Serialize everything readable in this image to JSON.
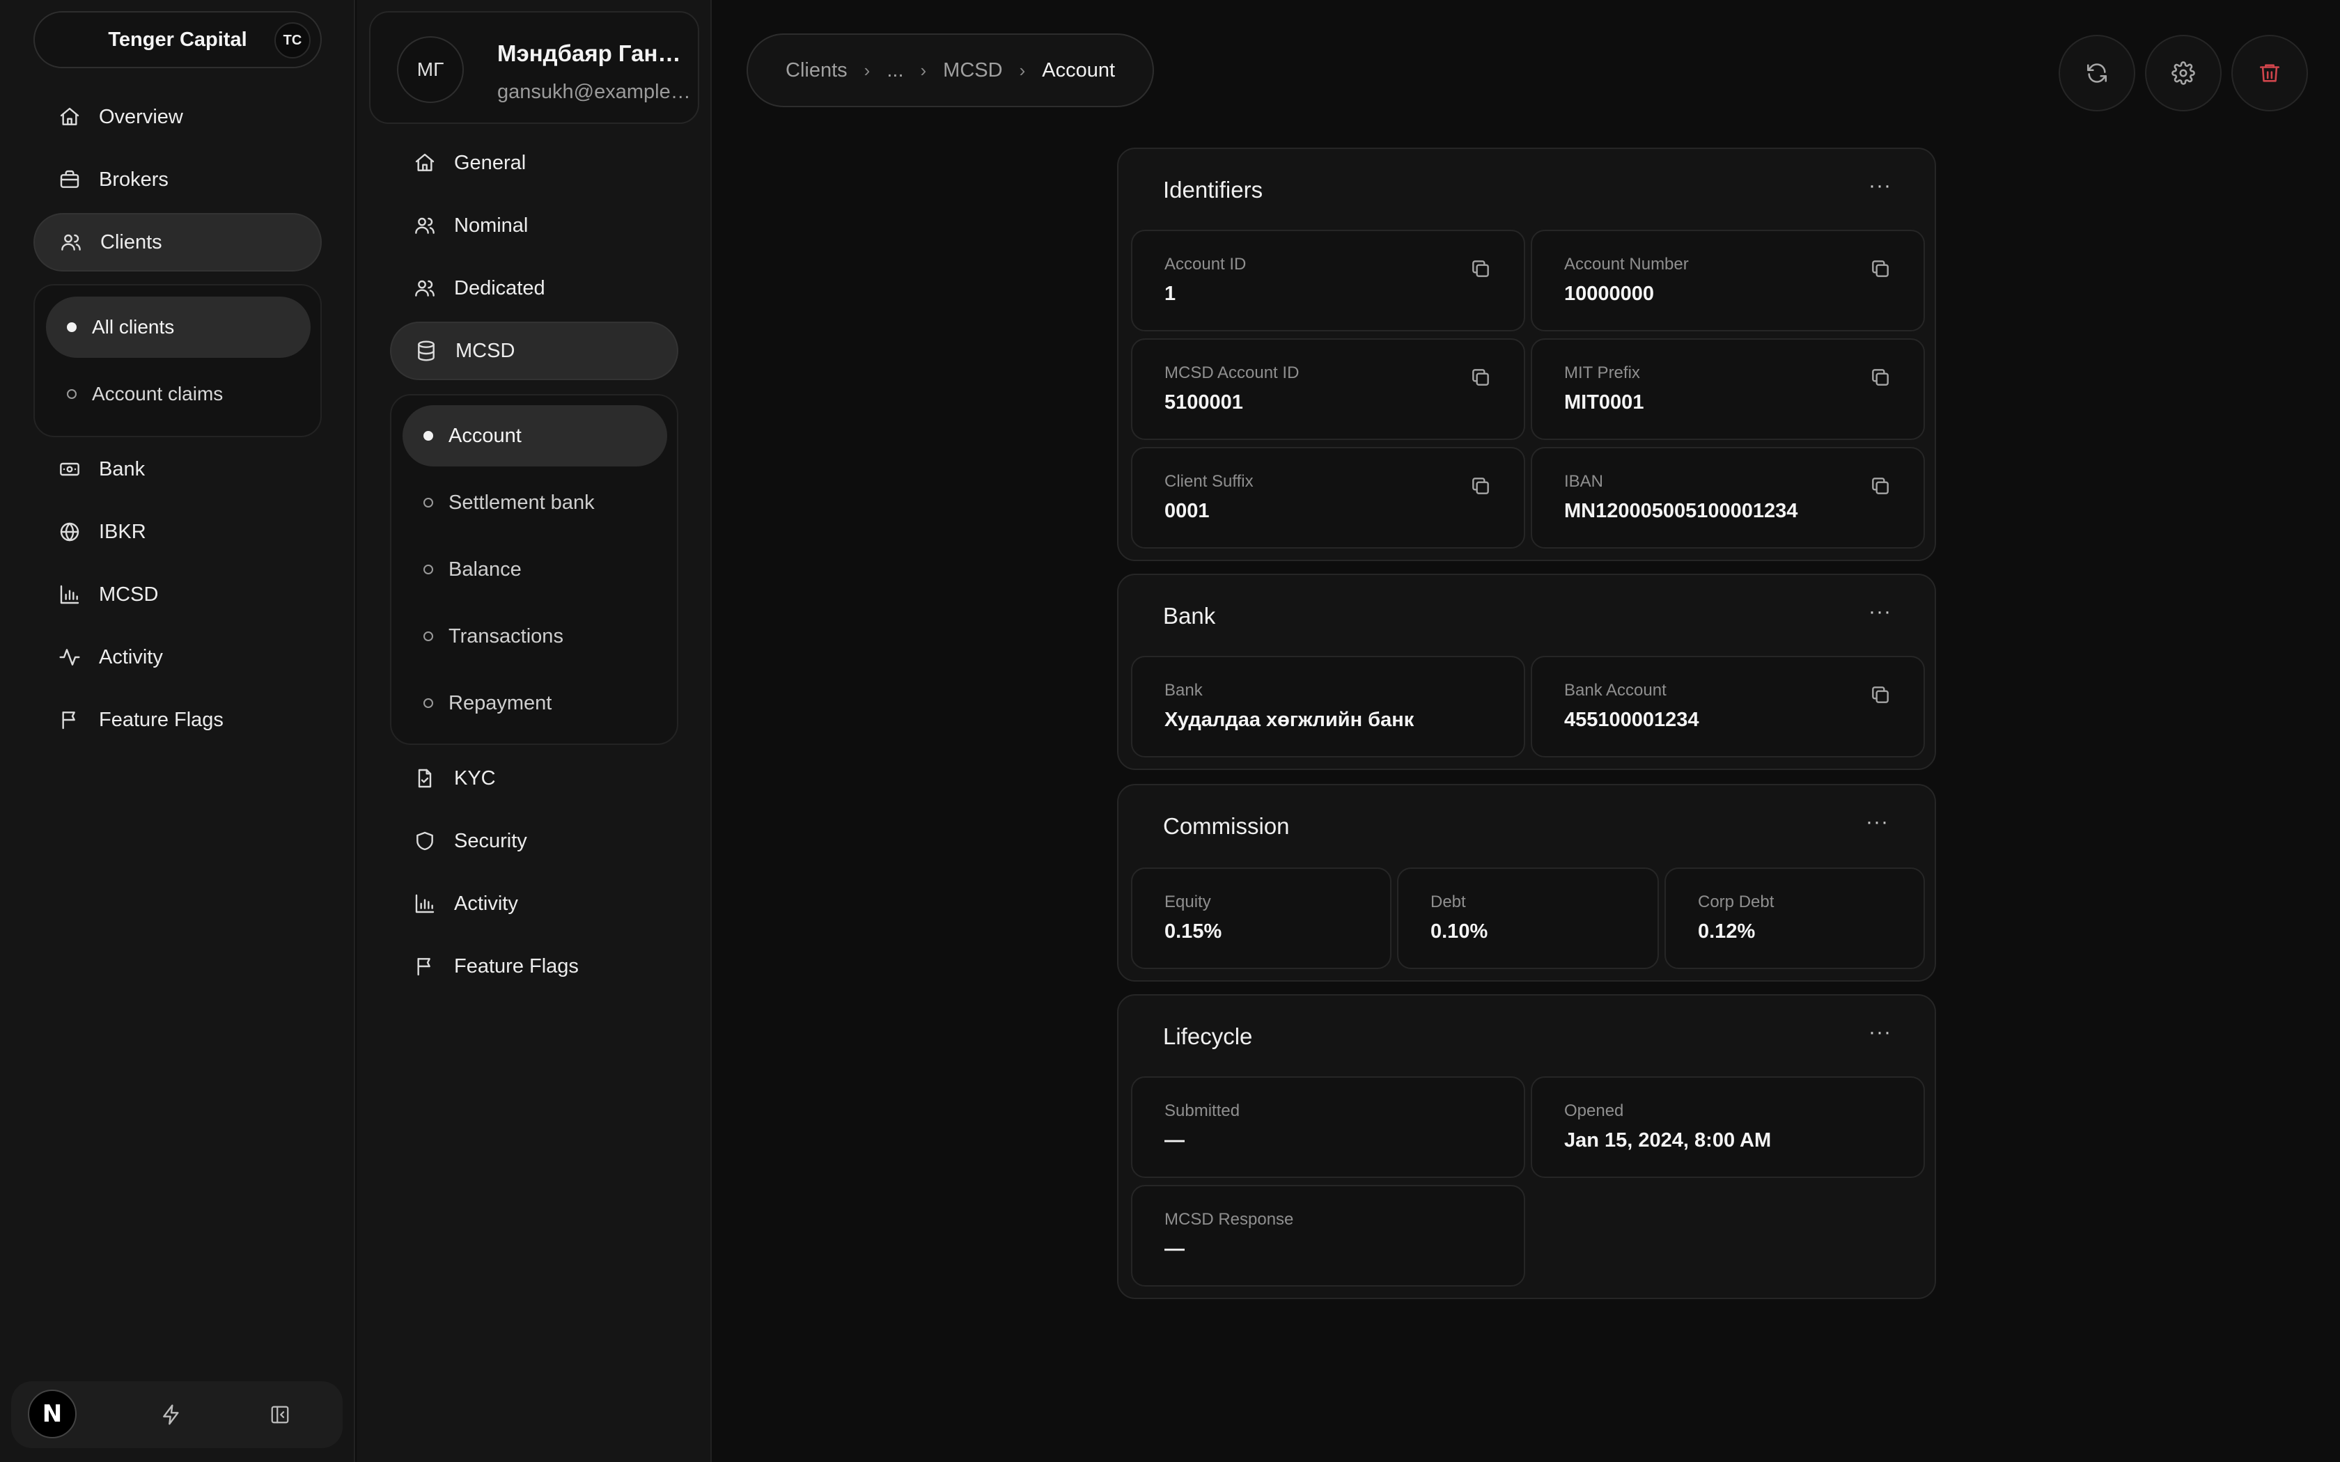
{
  "org": {
    "name": "Tenger Capital",
    "initials": "TC"
  },
  "sidebar": {
    "items": [
      {
        "label": "Overview"
      },
      {
        "label": "Brokers"
      },
      {
        "label": "Clients"
      },
      {
        "label": "Bank"
      },
      {
        "label": "IBKR"
      },
      {
        "label": "MCSD"
      },
      {
        "label": "Activity"
      },
      {
        "label": "Feature Flags"
      }
    ],
    "clients_sub": [
      {
        "label": "All clients"
      },
      {
        "label": "Account claims"
      }
    ],
    "footer": {
      "logo_letter": "N"
    }
  },
  "client": {
    "initials": "МГ",
    "name": "Мэндбаяр Гансүх",
    "email": "gansukh@example.com",
    "nav": [
      {
        "label": "General"
      },
      {
        "label": "Nominal"
      },
      {
        "label": "Dedicated"
      },
      {
        "label": "MCSD"
      },
      {
        "label": "KYC"
      },
      {
        "label": "Security"
      },
      {
        "label": "Activity"
      },
      {
        "label": "Feature Flags"
      }
    ],
    "mcsd_sub": [
      {
        "label": "Account"
      },
      {
        "label": "Settlement bank"
      },
      {
        "label": "Balance"
      },
      {
        "label": "Transactions"
      },
      {
        "label": "Repayment"
      }
    ]
  },
  "breadcrumb": [
    "Clients",
    "...",
    "MCSD",
    "Account"
  ],
  "colors": {
    "accent_danger": "#d0454c",
    "background": "#0d0d0d",
    "panel": "#151515"
  },
  "sections": {
    "identifiers": {
      "title": "Identifiers",
      "menu": "···",
      "fields": [
        {
          "label": "Account ID",
          "value": "1"
        },
        {
          "label": "Account Number",
          "value": "10000000"
        },
        {
          "label": "MCSD Account ID",
          "value": "5100001"
        },
        {
          "label": "MIT Prefix",
          "value": "MIT0001"
        },
        {
          "label": "Client Suffix",
          "value": "0001"
        },
        {
          "label": "IBAN",
          "value": "MN120005005100001234"
        }
      ]
    },
    "bank": {
      "title": "Bank",
      "menu": "···",
      "fields": [
        {
          "label": "Bank",
          "value": "Худалдаа хөгжлийн банк"
        },
        {
          "label": "Bank Account",
          "value": "455100001234"
        }
      ]
    },
    "commission": {
      "title": "Commission",
      "menu": "···",
      "fields": [
        {
          "label": "Equity",
          "value": "0.15%"
        },
        {
          "label": "Debt",
          "value": "0.10%"
        },
        {
          "label": "Corp Debt",
          "value": "0.12%"
        }
      ]
    },
    "lifecycle": {
      "title": "Lifecycle",
      "menu": "···",
      "fields": [
        {
          "label": "Submitted",
          "value": "—"
        },
        {
          "label": "Opened",
          "value": "Jan 15, 2024, 8:00 AM"
        },
        {
          "label": "MCSD Response",
          "value": "—"
        }
      ]
    }
  }
}
